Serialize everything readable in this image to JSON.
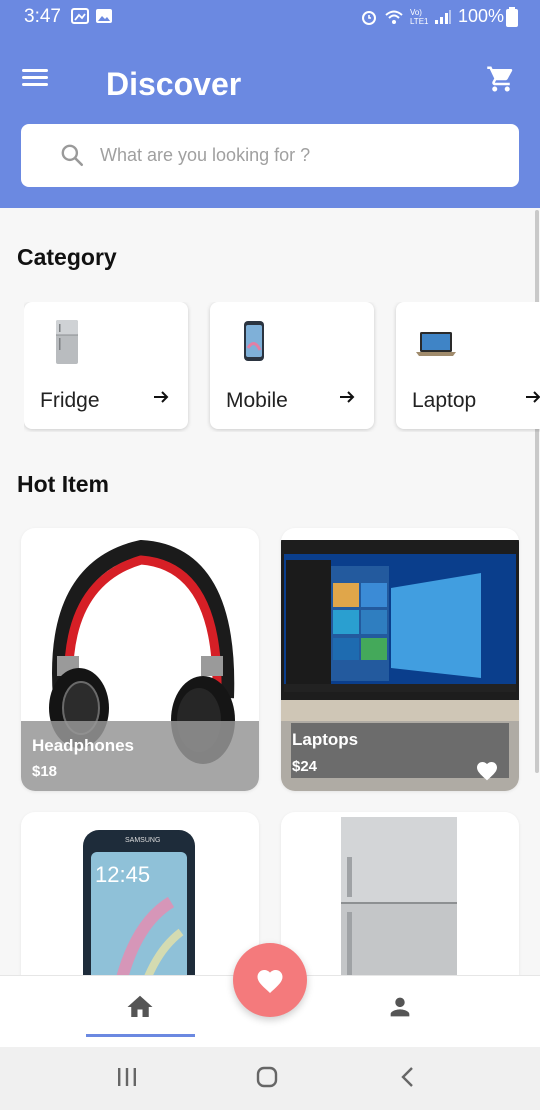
{
  "status_bar": {
    "time": "3:47",
    "battery": "100%",
    "network": "Vo) LTE1"
  },
  "app_bar": {
    "title": "Discover",
    "menu_icon": "hamburger-menu-icon",
    "cart_icon": "shopping-cart-icon"
  },
  "search": {
    "placeholder": "What are you looking for ?"
  },
  "category": {
    "title": "Category",
    "items": [
      {
        "label": "Fridge",
        "icon": "fridge-icon"
      },
      {
        "label": "Mobile",
        "icon": "mobile-icon"
      },
      {
        "label": "Laptop",
        "icon": "laptop-icon"
      }
    ]
  },
  "hot_item": {
    "title": "Hot Item",
    "items": [
      {
        "name": "Headphones",
        "price": "$18"
      },
      {
        "name": "Laptops",
        "price": "$24"
      },
      {
        "name": "",
        "price": ""
      },
      {
        "name": "",
        "price": ""
      }
    ]
  },
  "colors": {
    "primary": "#6b89e1",
    "fab": "#f47a7c",
    "background": "#f7f7f7"
  },
  "bottom_nav": {
    "items": [
      "home-icon",
      "favorite-icon",
      "profile-icon"
    ],
    "active": "home"
  }
}
